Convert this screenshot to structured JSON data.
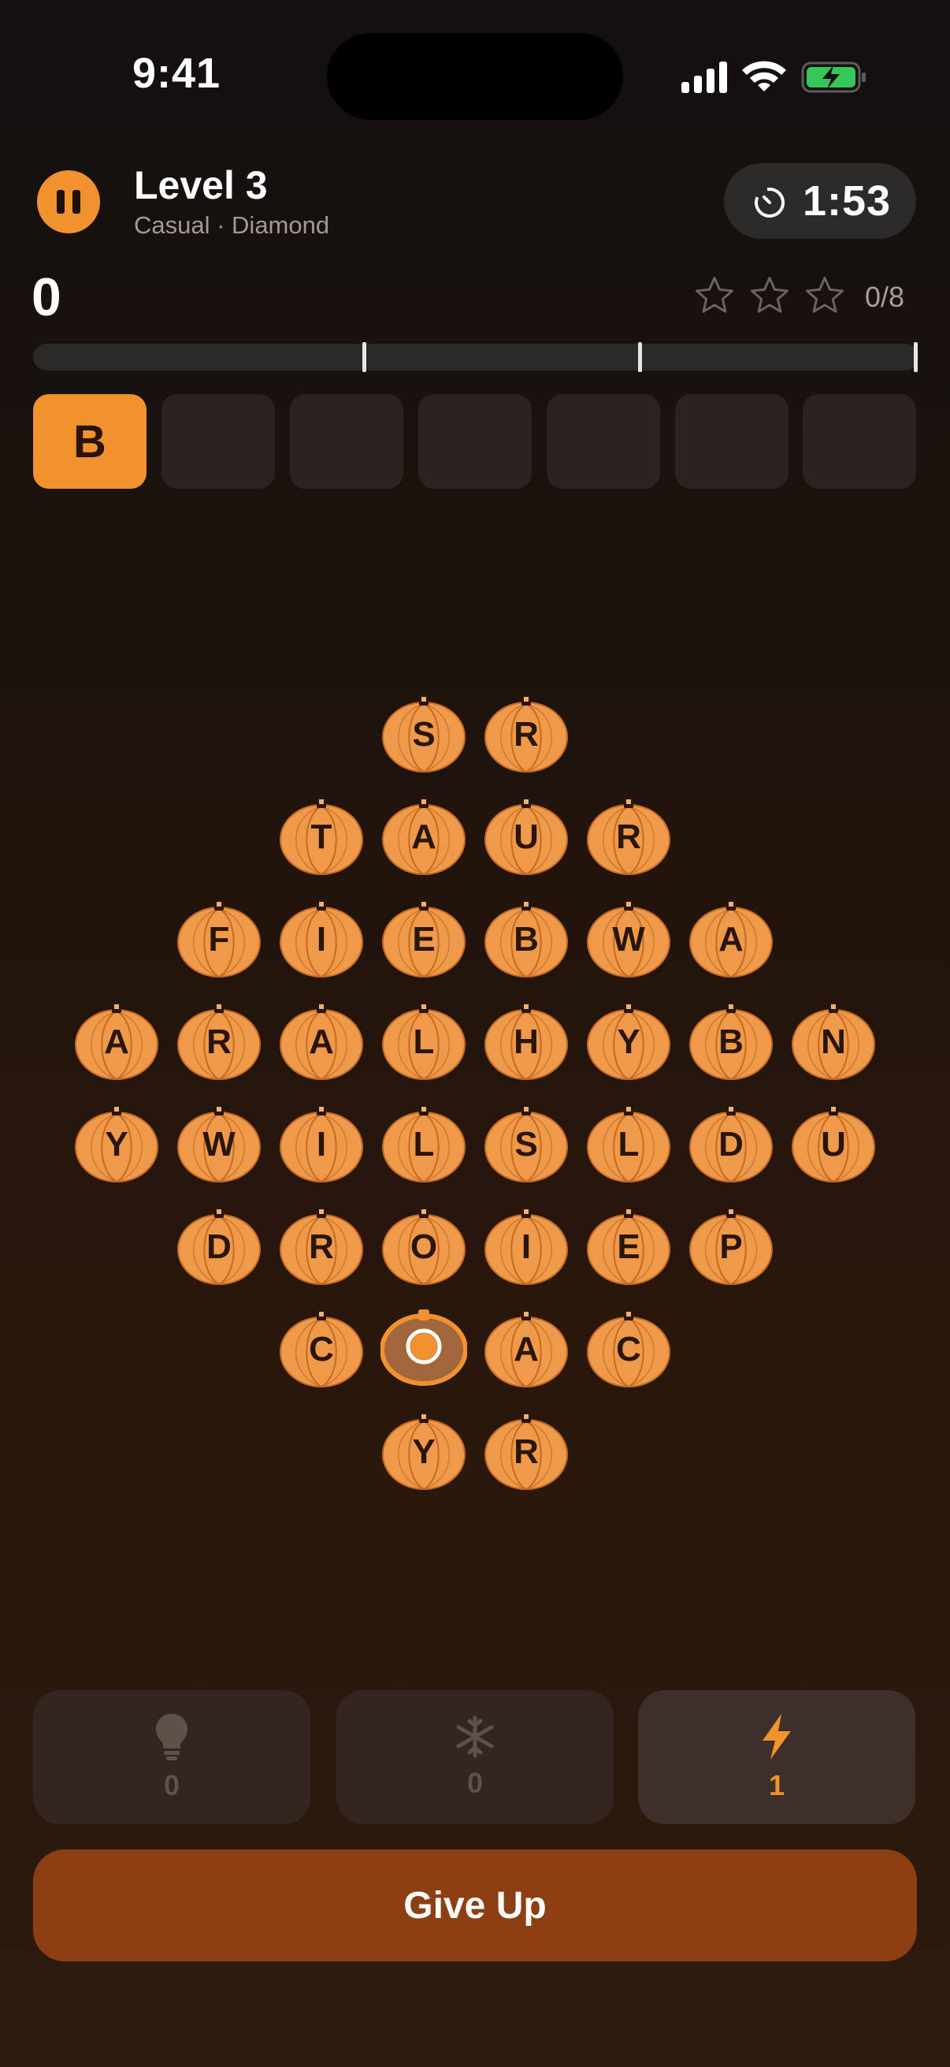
{
  "status_bar": {
    "time": "9:41"
  },
  "header": {
    "title": "Level 3",
    "subtitle": "Casual · Diamond",
    "timer": "1:53"
  },
  "score": {
    "value": "0",
    "stars_total": 3,
    "stars_earned": 0,
    "words_found": "0/8",
    "progress": 0
  },
  "slots": [
    "B",
    "",
    "",
    "",
    "",
    "",
    ""
  ],
  "board": {
    "rows": [
      [
        "S",
        "R"
      ],
      [
        "T",
        "A",
        "U",
        "R"
      ],
      [
        "F",
        "I",
        "E",
        "B",
        "W",
        "A"
      ],
      [
        "A",
        "R",
        "A",
        "L",
        "H",
        "Y",
        "B",
        "N"
      ],
      [
        "Y",
        "W",
        "I",
        "L",
        "S",
        "L",
        "D",
        "U"
      ],
      [
        "D",
        "R",
        "O",
        "I",
        "E",
        "P"
      ],
      [
        "C",
        "",
        "A",
        "C"
      ],
      [
        "Y",
        "R"
      ]
    ],
    "selected_cell": "row 7, position 2"
  },
  "powerups": [
    {
      "icon": "lightbulb-icon",
      "count": "0",
      "active": false
    },
    {
      "icon": "snowflake-icon",
      "count": "0",
      "active": false
    },
    {
      "icon": "lightning-icon",
      "count": "1",
      "active": true
    }
  ],
  "give_up_label": "Give Up",
  "colors": {
    "accent": "#f2922f",
    "button": "#8b3f12",
    "background": "#1a120d"
  }
}
